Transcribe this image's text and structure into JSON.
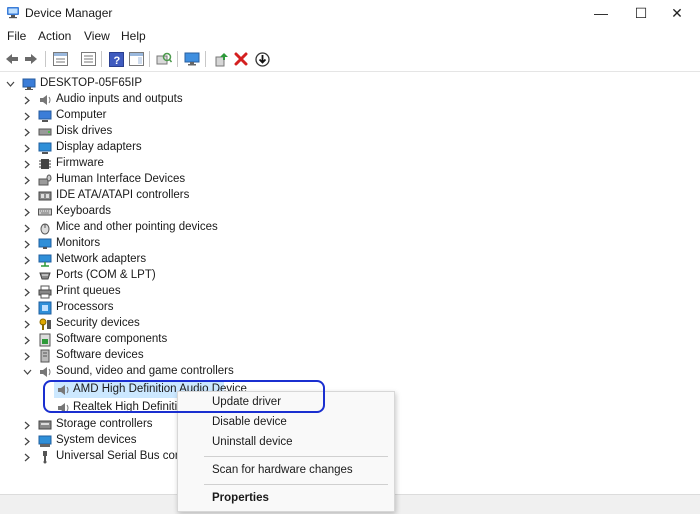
{
  "window": {
    "title": "Device Manager",
    "controls": {
      "minimize": "—",
      "maximize": "☐",
      "close": "✕"
    }
  },
  "menu": [
    "File",
    "Action",
    "View",
    "Help"
  ],
  "toolbar": {
    "buttons": [
      "back-arrow-icon",
      "forward-arrow-icon",
      "properties-pane-icon",
      "view-list-icon",
      "help-icon",
      "action-pane-icon",
      "scan-hardware-icon",
      "monitor-icon",
      "add-driver-icon",
      "uninstall-x-icon",
      "download-driver-icon"
    ]
  },
  "tree": {
    "root": "DESKTOP-05F65IP",
    "categories": [
      "Audio inputs and outputs",
      "Computer",
      "Disk drives",
      "Display adapters",
      "Firmware",
      "Human Interface Devices",
      "IDE ATA/ATAPI controllers",
      "Keyboards",
      "Mice and other pointing devices",
      "Monitors",
      "Network adapters",
      "Ports (COM & LPT)",
      "Print queues",
      "Processors",
      "Security devices",
      "Software components",
      "Software devices",
      "Sound, video and game controllers"
    ],
    "children": [
      "AMD High Definition Audio Device",
      "Realtek High Definition Audio"
    ],
    "after": [
      "Storage controllers",
      "System devices",
      "Universal Serial Bus controllers"
    ]
  },
  "context_menu": {
    "update": "Update driver",
    "disable": "Disable device",
    "uninstall": "Uninstall device",
    "scan": "Scan for hardware changes",
    "properties": "Properties"
  },
  "colors": {
    "highlight_outline": "#1a2fd0",
    "selection": "#cce8ff"
  }
}
